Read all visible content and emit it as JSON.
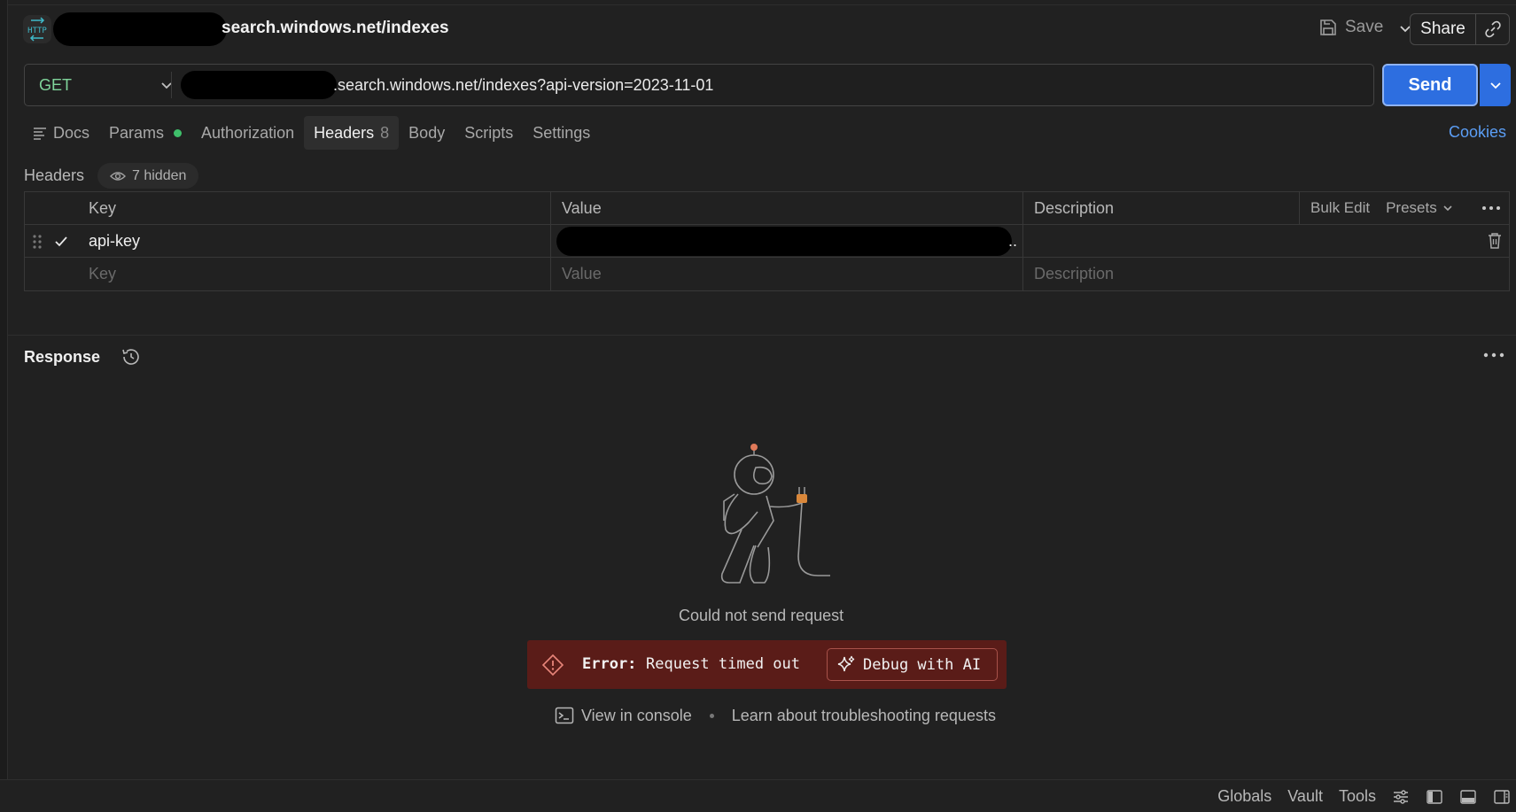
{
  "app": {
    "title": "search.windows.net/indexes",
    "http_icon_label": "HTTP"
  },
  "toolbar": {
    "save_label": "Save",
    "share_label": "Share"
  },
  "request": {
    "method": "GET",
    "url": ".search.windows.net/indexes?api-version=2023-11-01",
    "send_label": "Send"
  },
  "tabs": [
    {
      "label": "Docs",
      "icon": "docs-icon"
    },
    {
      "label": "Params",
      "indicator": "green-dot"
    },
    {
      "label": "Authorization"
    },
    {
      "label": "Headers",
      "count": "8",
      "active": true
    },
    {
      "label": "Body"
    },
    {
      "label": "Scripts"
    },
    {
      "label": "Settings"
    }
  ],
  "cookies_label": "Cookies",
  "headers_section": {
    "label": "Headers",
    "hidden_count_label": "7 hidden",
    "columns": {
      "key": "Key",
      "value": "Value",
      "description": "Description"
    },
    "bulk_edit_label": "Bulk Edit",
    "presets_label": "Presets",
    "rows": [
      {
        "checked": true,
        "key": "api-key",
        "value": "..",
        "description": ""
      }
    ],
    "placeholders": {
      "key": "Key",
      "value": "Value",
      "description": "Description"
    }
  },
  "response": {
    "title": "Response",
    "empty_message": "Could not send request",
    "error_label": "Error:",
    "error_message": "Request timed out",
    "debug_label": "Debug with AI",
    "view_console_label": "View in console",
    "learn_label": "Learn about troubleshooting requests"
  },
  "status_bar": {
    "globals_label": "Globals",
    "vault_label": "Vault",
    "tools_label": "Tools"
  },
  "colors": {
    "background": "#212121",
    "accent_blue": "#2d6ee0",
    "method_green": "#7fd49a",
    "error_bg": "#5a1c18",
    "link_blue": "#5b9ef5"
  }
}
